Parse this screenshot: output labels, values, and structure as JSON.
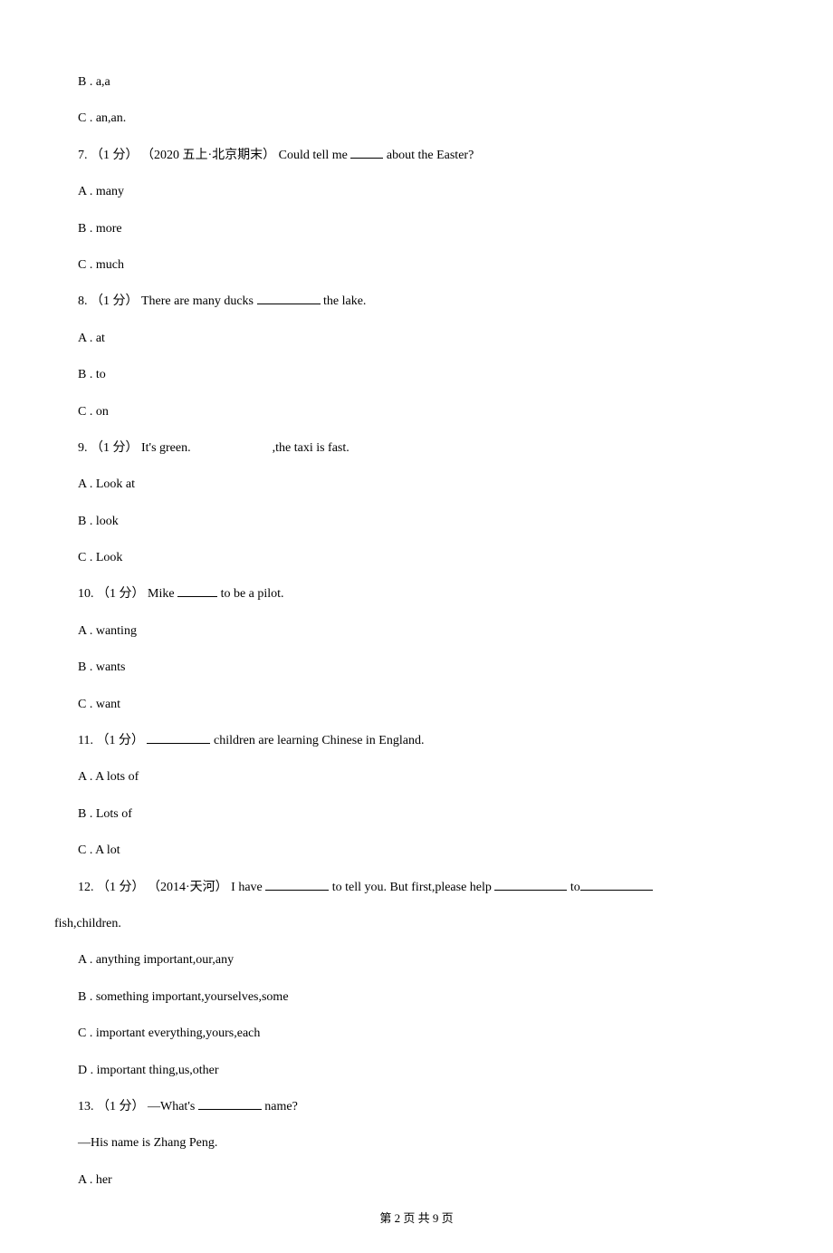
{
  "options_pre": [
    "B . a,a",
    "C . an,an."
  ],
  "questions": [
    {
      "num": "7.",
      "points": "（1 分）",
      "source": "（2020 五上·北京期末）",
      "stem_before": "Could tell me ",
      "stem_after": " about the Easter?",
      "options": [
        "A . many",
        "B . more",
        "C . much"
      ]
    },
    {
      "num": "8.",
      "points": "（1 分）",
      "stem_before": " There are many ducks ",
      "stem_after": " the lake.",
      "options": [
        "A . at",
        "B . to",
        "C . on"
      ]
    },
    {
      "num": "9.",
      "points": "（1 分）",
      "stem_before": " It's green.",
      "stem_after": ",the taxi is fast.",
      "options": [
        "A . Look at",
        "B . look",
        "C . Look"
      ]
    },
    {
      "num": "10.",
      "points": "（1 分）",
      "stem_before": " Mike ",
      "stem_after": " to be a pilot.",
      "options": [
        "A . wanting",
        "B . wants",
        "C . want"
      ]
    },
    {
      "num": "11.",
      "points": "（1 分）",
      "stem_before": " ",
      "stem_after": " children are learning Chinese in England.",
      "options": [
        "A . A lots of",
        "B . Lots of",
        "C . A lot"
      ]
    },
    {
      "num": "12.",
      "points": "（1 分）",
      "source": "（2014·天河）",
      "stem_p1": "I have ",
      "stem_p2": " to tell you. But first,please help ",
      "stem_p3": " to",
      "stem_line2": "fish,children.",
      "options": [
        "A . anything important,our,any",
        "B . something important,yourselves,some",
        "C . important everything,yours,each",
        "D . important thing,us,other"
      ]
    },
    {
      "num": "13.",
      "points": "（1 分）",
      "stem_before": " —What's ",
      "stem_after": " name?",
      "line2": "—His name is Zhang Peng.",
      "options": [
        "A . her"
      ]
    }
  ],
  "footer": "第 2 页 共 9 页"
}
